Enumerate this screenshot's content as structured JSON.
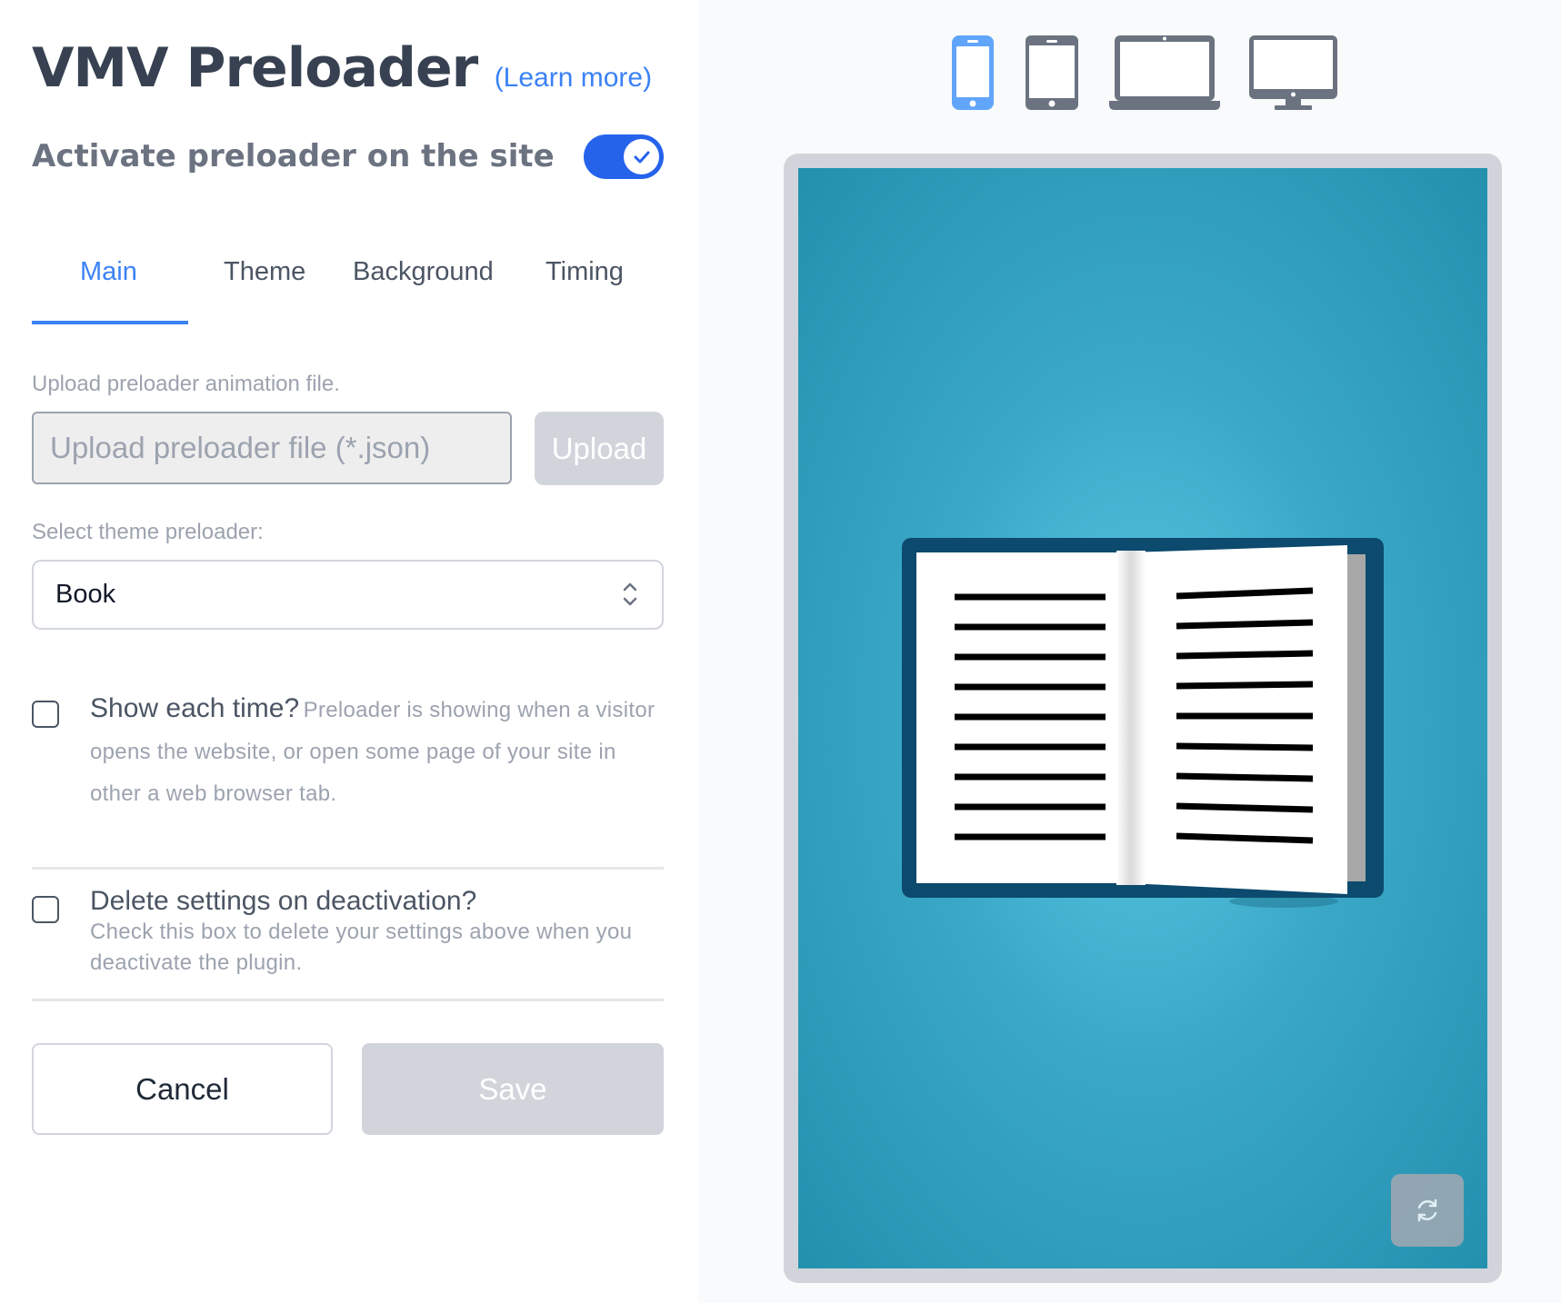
{
  "header": {
    "title": "VMV Preloader",
    "learn_more": "(Learn more)"
  },
  "activate": {
    "label": "Activate preloader on the site",
    "enabled": true
  },
  "tabs": [
    {
      "label": "Main",
      "active": true
    },
    {
      "label": "Theme",
      "active": false
    },
    {
      "label": "Background",
      "active": false
    },
    {
      "label": "Timing",
      "active": false
    }
  ],
  "upload": {
    "label": "Upload preloader animation file.",
    "placeholder": "Upload preloader file (*.json)",
    "button": "Upload"
  },
  "theme_select": {
    "label": "Select theme preloader:",
    "value": "Book"
  },
  "options": {
    "show_each_time": {
      "title": "Show each time?",
      "description": "Preloader is showing when a visitor opens the website, or open some page of your site in other a web browser tab.",
      "checked": false
    },
    "delete_settings": {
      "title": "Delete settings on deactivation?",
      "description": "Check this box to delete your settings above when you deactivate the plugin.",
      "checked": false
    }
  },
  "actions": {
    "cancel": "Cancel",
    "save": "Save"
  },
  "devices": [
    {
      "icon": "phone-icon",
      "active": true
    },
    {
      "icon": "tablet-icon",
      "active": false
    },
    {
      "icon": "laptop-icon",
      "active": false
    },
    {
      "icon": "desktop-icon",
      "active": false
    }
  ],
  "preview": {
    "theme": "Book",
    "background_color": "#3aa7c7",
    "book_cover_color": "#0c4a6e"
  },
  "colors": {
    "accent": "#3b82f6",
    "toggle": "#2563eb",
    "device_active": "#60a5fa",
    "device_inactive": "#6b7280"
  }
}
